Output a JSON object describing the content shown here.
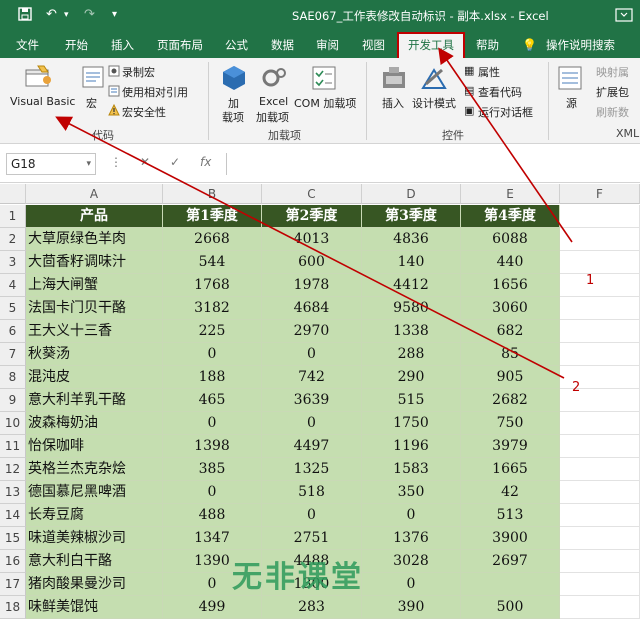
{
  "window": {
    "title": "SAE067_工作表修改自动标识 - 副本.xlsx  -  Excel"
  },
  "tabs": [
    "文件",
    "开始",
    "插入",
    "页面布局",
    "公式",
    "数据",
    "审阅",
    "视图",
    "开发工具",
    "帮助",
    "操作说明搜索"
  ],
  "active_tab": "开发工具",
  "ribbon": {
    "code": {
      "visual_basic": "Visual Basic",
      "macros": "宏",
      "record_macro": "录制宏",
      "relative_refs": "使用相对引用",
      "macro_security": "宏安全性",
      "group": "代码"
    },
    "addins": {
      "addins": "加载项",
      "excel_addins": "Excel 加载项",
      "com_addins": "COM 加载项",
      "group": "加载项"
    },
    "controls": {
      "insert": "插入",
      "design_mode": "设计模式",
      "properties": "属性",
      "view_code": "查看代码",
      "run_dialog": "运行对话框",
      "group": "控件"
    },
    "xml": {
      "source": "源",
      "map_props": "映射属",
      "ext_pack": "扩展包",
      "refresh": "刷新数",
      "group": "XML"
    }
  },
  "formula_bar": {
    "name_box": "G18",
    "fx": "fx",
    "value": ""
  },
  "columns": [
    "A",
    "B",
    "C",
    "D",
    "E",
    "F"
  ],
  "rows": [
    [
      "产品",
      "第1季度",
      "第2季度",
      "第3季度",
      "第4季度"
    ],
    [
      "大草原绿色羊肉",
      "2668",
      "4013",
      "4836",
      "6088"
    ],
    [
      "大茴香籽调味汁",
      "544",
      "600",
      "140",
      "440"
    ],
    [
      "上海大闸蟹",
      "1768",
      "1978",
      "4412",
      "1656"
    ],
    [
      "法国卡门贝干酪",
      "3182",
      "4684",
      "9580",
      "3060"
    ],
    [
      "王大义十三香",
      "225",
      "2970",
      "1338",
      "682"
    ],
    [
      "秋葵汤",
      "0",
      "0",
      "288",
      "85"
    ],
    [
      "混沌皮",
      "188",
      "742",
      "290",
      "905"
    ],
    [
      "意大利羊乳干酪",
      "465",
      "3639",
      "515",
      "2682"
    ],
    [
      "波森梅奶油",
      "0",
      "0",
      "1750",
      "750"
    ],
    [
      "怡保咖啡",
      "1398",
      "4497",
      "1196",
      "3979"
    ],
    [
      "英格兰杰克杂烩",
      "385",
      "1325",
      "1583",
      "1665"
    ],
    [
      "德国慕尼黑啤酒",
      "0",
      "518",
      "350",
      "42"
    ],
    [
      "长寿豆腐",
      "488",
      "0",
      "0",
      "513"
    ],
    [
      "味道美辣椒沙司",
      "1347",
      "2751",
      "1376",
      "3900"
    ],
    [
      "意大利白干酪",
      "1390",
      "4488",
      "3028",
      "2697"
    ],
    [
      "猪肉酸果曼沙司",
      "0",
      "1300",
      "0",
      ""
    ],
    [
      "味鲜美馄饨",
      "499",
      "283",
      "390",
      "500"
    ]
  ],
  "annotations": [
    "1",
    "2"
  ],
  "watermark": "无非课堂",
  "colors": {
    "excel_green": "#217346",
    "header_fill": "#375623",
    "body_fill": "#c5deb0",
    "arrow": "#c00000"
  }
}
